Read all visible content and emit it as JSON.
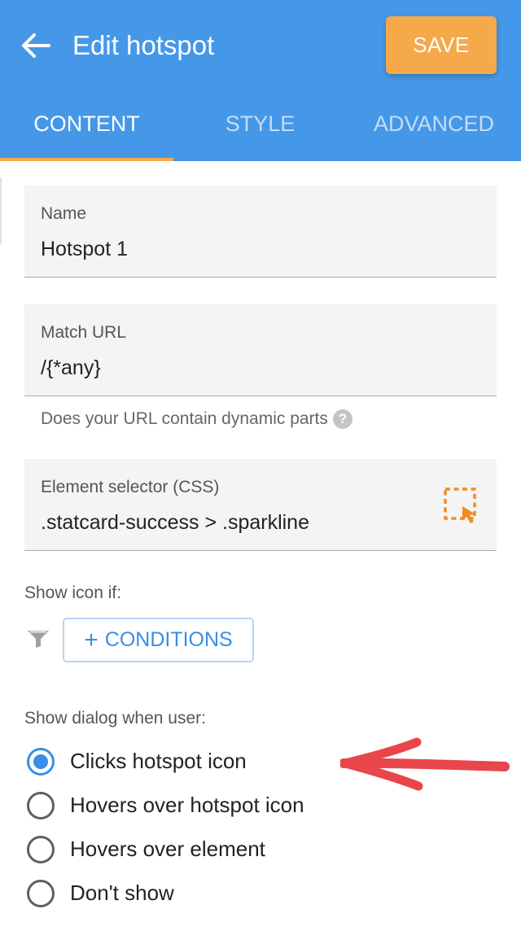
{
  "header": {
    "title": "Edit hotspot",
    "save_label": "SAVE",
    "back_icon": "arrow-left-icon",
    "background_color": "#4597e8",
    "accent_color": "#f5a94b"
  },
  "tabs": [
    {
      "label": "CONTENT",
      "active": true
    },
    {
      "label": "STYLE",
      "active": false
    },
    {
      "label": "ADVANCED",
      "active": false
    }
  ],
  "form": {
    "name": {
      "label": "Name",
      "value": "Hotspot 1"
    },
    "match_url": {
      "label": "Match URL",
      "value": "/{*any}",
      "helper": "Does your URL contain dynamic parts",
      "help_icon": "question-icon"
    },
    "selector": {
      "label": "Element selector (CSS)",
      "value": ".statcard-success > .sparkline",
      "picker_icon": "element-picker-icon"
    }
  },
  "show_icon": {
    "label": "Show icon if:",
    "filter_icon": "filter-icon",
    "conditions_label": "CONDITIONS"
  },
  "show_dialog": {
    "label": "Show dialog when user:",
    "options": [
      {
        "label": "Clicks hotspot icon",
        "selected": true
      },
      {
        "label": "Hovers over hotspot icon",
        "selected": false
      },
      {
        "label": "Hovers over element",
        "selected": false
      },
      {
        "label": "Don't show",
        "selected": false
      }
    ],
    "annotation": {
      "icon": "red-arrow-annotation",
      "color": "#e8464a"
    }
  }
}
